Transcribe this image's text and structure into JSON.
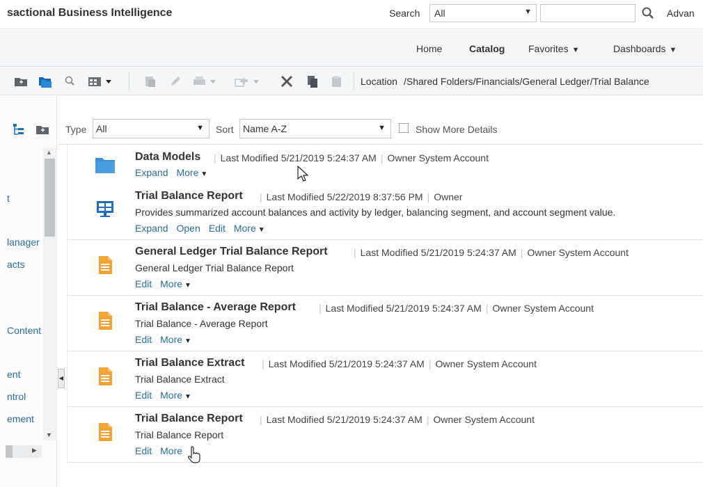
{
  "header": {
    "app_title": "sactional Business Intelligence",
    "search_label": "Search",
    "search_scope": "All",
    "advanced_label": "Advan"
  },
  "nav": {
    "home": "Home",
    "catalog": "Catalog",
    "favorites": "Favorites",
    "dashboards": "Dashboards"
  },
  "toolbar": {
    "location_label": "Location",
    "location_path": "/Shared Folders/Financials/General Ledger/Trial Balance"
  },
  "left_pane": {
    "items": [
      "t",
      "lanager",
      "acts",
      "Content",
      "ent",
      "ntrol",
      "ement"
    ]
  },
  "filters": {
    "type_label": "Type",
    "type_value": "All",
    "sort_label": "Sort",
    "sort_value": "Name A-Z",
    "show_more_label": "Show More Details",
    "show_more_checked": false
  },
  "items": [
    {
      "title": "Data Models",
      "modified": "Last Modified 5/21/2019 5:24:37 AM",
      "owner": "Owner System Account",
      "description": "",
      "icon": "folder-icon",
      "actions": [
        "Expand",
        "More"
      ]
    },
    {
      "title": "Trial Balance Report",
      "modified": "Last Modified 5/22/2019 8:37:56 PM",
      "owner": "Owner",
      "description": "Provides summarized account balances and activity by ledger, balancing segment, and account segment value.",
      "icon": "report-icon",
      "actions": [
        "Expand",
        "Open",
        "Edit",
        "More"
      ]
    },
    {
      "title": "General Ledger Trial Balance Report",
      "modified": "Last Modified 5/21/2019 5:24:37 AM",
      "owner": "Owner System Account",
      "description": "General Ledger Trial Balance Report",
      "icon": "document-icon",
      "actions": [
        "Edit",
        "More"
      ]
    },
    {
      "title": "Trial Balance - Average Report",
      "modified": "Last Modified 5/21/2019 5:24:37 AM",
      "owner": "Owner System Account",
      "description": "Trial Balance - Average Report",
      "icon": "document-icon",
      "actions": [
        "Edit",
        "More"
      ]
    },
    {
      "title": "Trial Balance Extract",
      "modified": "Last Modified 5/21/2019 5:24:37 AM",
      "owner": "Owner System Account",
      "description": "Trial Balance Extract",
      "icon": "document-icon",
      "actions": [
        "Edit",
        "More"
      ]
    },
    {
      "title": "Trial Balance Report",
      "modified": "Last Modified 5/21/2019 5:24:37 AM",
      "owner": "Owner System Account",
      "description": "Trial Balance Report",
      "icon": "document-icon",
      "actions": [
        "Edit",
        "More"
      ]
    }
  ],
  "colors": {
    "link": "#2b6ca3",
    "folder": "#3d8fd1",
    "document": "#f0a435"
  }
}
